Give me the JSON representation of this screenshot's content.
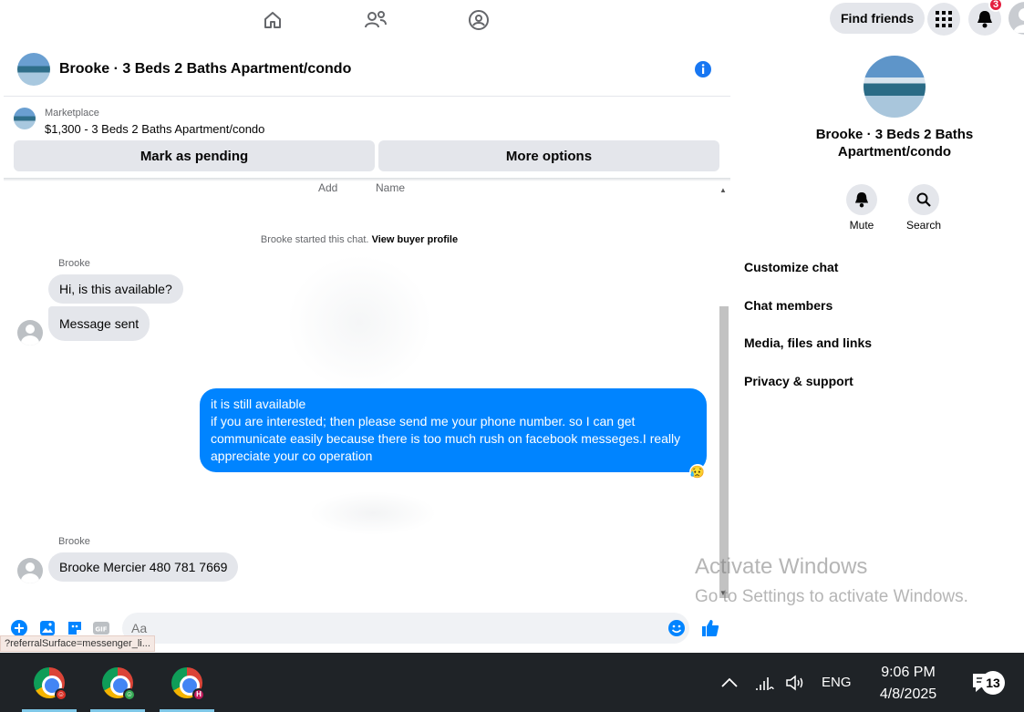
{
  "nav": {
    "icons": [
      "home-icon",
      "friends-icon",
      "groups-icon"
    ],
    "find_friends": "Find friends",
    "notification_count": "3"
  },
  "chat": {
    "title": "Brooke · 3 Beds 2 Baths Apartment/condo",
    "marketplace_label": "Marketplace",
    "listing": "$1,300 - 3 Beds 2 Baths Apartment/condo",
    "mark_pending": "Mark as pending",
    "more_options": "More options",
    "cut_label_1": "Add",
    "cut_label_2": "Name",
    "system_prefix": "Brooke started this chat.",
    "system_link": "View buyer profile",
    "messages": [
      {
        "sender": "Brooke",
        "text": "Hi, is this available?"
      },
      {
        "sender": "",
        "text": "Message sent"
      },
      {
        "sender": "me",
        "lines": [
          "it is still available",
          "if you are interested; then please send me your phone number. so I can get communicate easily because there is too much rush on facebook messeges.I really appreciate your co operation"
        ]
      },
      {
        "sender": "Brooke",
        "text": "Brooke Mercier 480 781 7669"
      }
    ],
    "reaction": "😥",
    "composer_placeholder": "Aa",
    "status_url": "?referralSurface=messenger_li..."
  },
  "details": {
    "name": "Brooke · 3 Beds 2 Baths Apartment/condo",
    "mute": "Mute",
    "search": "Search",
    "items": [
      "Customize chat",
      "Chat members",
      "Media, files and links",
      "Privacy & support"
    ]
  },
  "watermark": {
    "line1": "Activate Windows",
    "line2": "Go to Settings to activate Windows."
  },
  "taskbar": {
    "lang": "ENG",
    "time": "9:06 PM",
    "date": "4/8/2025",
    "notifications": "13",
    "profile_3_letter": "H"
  },
  "colors": {
    "accent": "#0084ff",
    "taskbar": "#1f2327"
  }
}
